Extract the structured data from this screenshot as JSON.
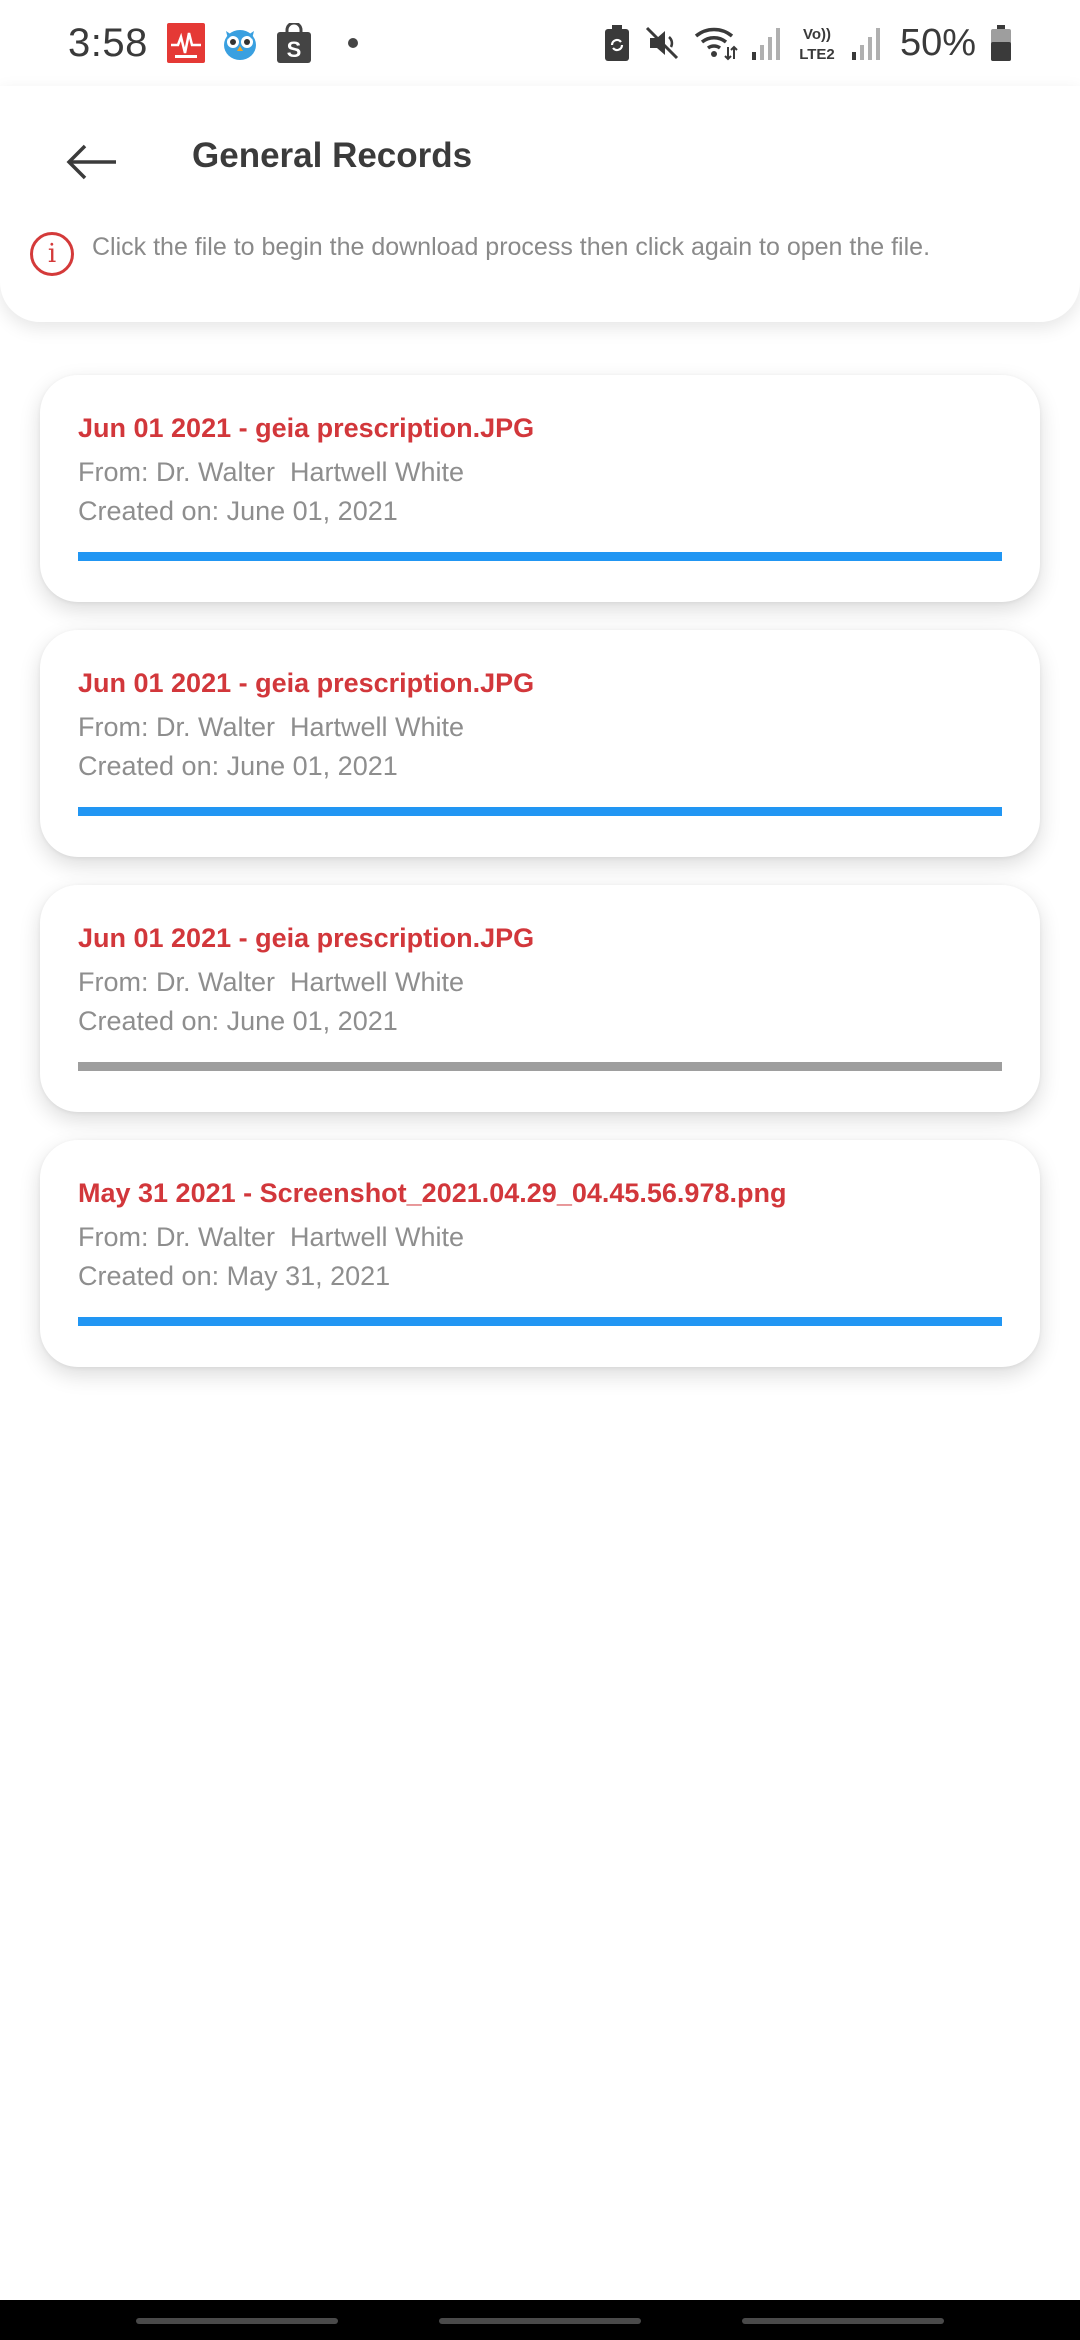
{
  "status_bar": {
    "time": "3:58",
    "battery_percent": "50%",
    "icons": [
      "ecg-app-icon",
      "owl-app-icon",
      "shopping-bag-icon",
      "notification-dot",
      "battery-saver-icon",
      "mute-icon",
      "wifi-icon",
      "signal-icon",
      "volte-lte2-icon",
      "signal-icon",
      "battery-icon"
    ],
    "notification_icon_colors": {
      "ecg": "#e53935",
      "owl": "#3aa0e0",
      "bag": "#444444"
    },
    "volte_label_top": "Vo))",
    "volte_label_bottom": "LTE2"
  },
  "header": {
    "title": "General Records",
    "back_icon": "arrow-left-icon",
    "info_icon": "info-icon",
    "info_icon_glyph": "i",
    "info_text": "Click the file to begin the download process then click again to open the file."
  },
  "records": [
    {
      "title": "Jun 01 2021 - geia prescription.JPG",
      "from": "From: Dr. Walter  Hartwell White",
      "created": "Created on: June 01, 2021",
      "progress": 1.0,
      "progress_color": "#2196f3"
    },
    {
      "title": "Jun 01 2021 - geia prescription.JPG",
      "from": "From: Dr. Walter  Hartwell White",
      "created": "Created on: June 01, 2021",
      "progress": 1.0,
      "progress_color": "#2196f3"
    },
    {
      "title": "Jun 01 2021 - geia prescription.JPG",
      "from": "From: Dr. Walter  Hartwell White",
      "created": "Created on: June 01, 2021",
      "progress": 1.0,
      "progress_color": "#9e9e9e"
    },
    {
      "title": "May 31 2021 - Screenshot_2021.04.29_04.45.56.978.png",
      "from": "From: Dr. Walter  Hartwell White",
      "created": "Created on: May 31, 2021",
      "progress": 1.0,
      "progress_color": "#2196f3"
    }
  ],
  "colors": {
    "accent_red": "#d2373b",
    "progress_blue": "#2196f3",
    "progress_grey": "#9e9e9e",
    "muted_text": "#8e8e8e"
  }
}
